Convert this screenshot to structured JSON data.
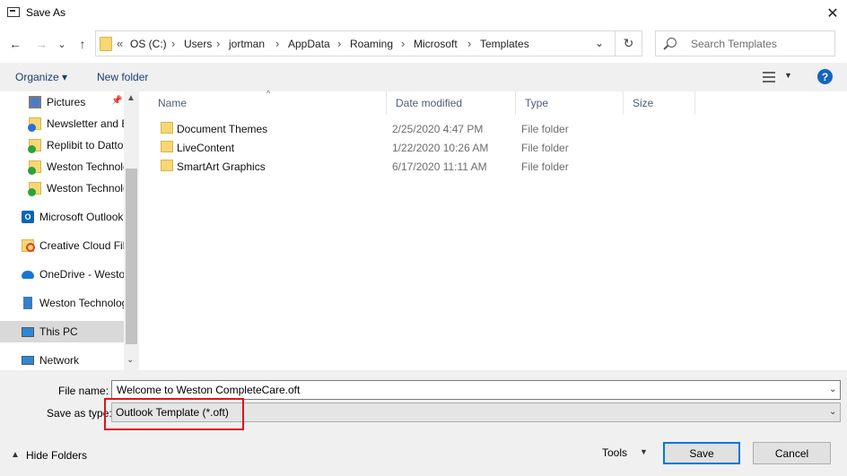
{
  "window": {
    "title": "Save As",
    "close_glyph": "✕"
  },
  "nav": {
    "back_glyph": "←",
    "forward_glyph": "→",
    "recent_glyph": "⌄",
    "up_glyph": "↑",
    "refresh_glyph": "↻",
    "breadcrumb_overflow": "«",
    "breadcrumb": [
      "OS (C:)",
      "Users",
      "jortman",
      "AppData",
      "Roaming",
      "Microsoft",
      "Templates"
    ],
    "separator": "›",
    "dropdown_glyph": "⌄",
    "search_placeholder": "Search Templates"
  },
  "toolbar": {
    "organize_label": "Organize ▾",
    "new_folder_label": "New folder",
    "view_dd": "▼",
    "help_label": "?"
  },
  "navpane": {
    "items": [
      {
        "label": "Pictures",
        "icon": "pictures-icon"
      },
      {
        "label": "Newsletter and E",
        "icon": "folder-sync-icon"
      },
      {
        "label": "Replibit to Datto",
        "icon": "folder-check-icon"
      },
      {
        "label": "Weston Technolo",
        "icon": "folder-check-icon"
      },
      {
        "label": "Weston Technolo",
        "icon": "folder-check-icon"
      },
      {
        "label": "Microsoft Outlook",
        "icon": "outlook-icon"
      },
      {
        "label": "Creative Cloud Fil",
        "icon": "creative-cloud-icon"
      },
      {
        "label": "OneDrive - Westo",
        "icon": "onedrive-icon"
      },
      {
        "label": "Weston Technolog",
        "icon": "building-icon"
      },
      {
        "label": "This PC",
        "icon": "this-pc-icon"
      },
      {
        "label": "Network",
        "icon": "network-icon"
      }
    ],
    "pin_glyph": "📌",
    "scroll_up": "▲",
    "scroll_down": "⌄"
  },
  "filelist": {
    "columns": [
      "Name",
      "Date modified",
      "Type",
      "Size"
    ],
    "sort_glyph": "^",
    "rows": [
      {
        "name": "Document Themes",
        "date": "2/25/2020 4:47 PM",
        "type": "File folder"
      },
      {
        "name": "LiveContent",
        "date": "1/22/2020 10:26 AM",
        "type": "File folder"
      },
      {
        "name": "SmartArt Graphics",
        "date": "6/17/2020 11:11 AM",
        "type": "File folder"
      }
    ]
  },
  "form": {
    "file_name_label": "File name:",
    "file_name_value": "Welcome to Weston CompleteCare.oft",
    "save_as_type_label": "Save as type:",
    "save_as_type_value": "Outlook Template (*.oft)",
    "dropdown_glyph": "⌄"
  },
  "footer": {
    "hide_folders_glyph": "▲",
    "hide_folders_label": "Hide Folders",
    "tools_label": "Tools",
    "tools_dd": "▼",
    "save_label": "Save",
    "cancel_label": "Cancel"
  },
  "colors": {
    "highlight_border": "#e0141b",
    "accent": "#0078d7",
    "selected_nav": "#d9d9d9"
  }
}
